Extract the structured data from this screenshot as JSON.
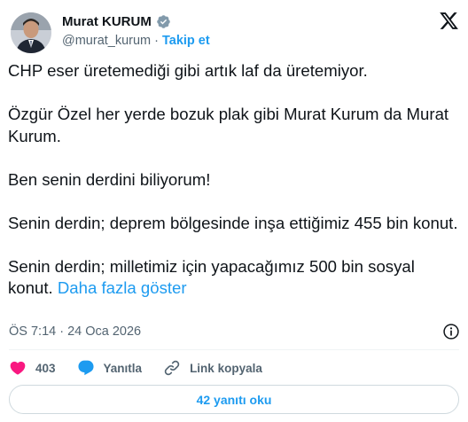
{
  "author": {
    "name": "Murat KURUM",
    "handle": "@murat_kurum",
    "separator": "·",
    "follow_label": "Takip et"
  },
  "tweet": {
    "paragraphs": [
      "CHP eser üretemediği gibi artık laf da üretemiyor.",
      "Özgür Özel her yerde bozuk plak gibi Murat Kurum da Murat Kurum.",
      "Ben senin derdini biliyorum!",
      "Senin derdin; deprem bölgesinde inşa ettiğimiz 455 bin konut.",
      "Senin derdin; milletimiz için yapacağımız 500 bin sosyal konut."
    ],
    "show_more": "Daha fazla göster"
  },
  "meta": {
    "timestamp": "ÖS 7:14 · 24 Oca 2026"
  },
  "actions": {
    "like_count": "403",
    "reply_label": "Yanıtla",
    "copy_link_label": "Link kopyala"
  },
  "read_replies_label": "42 yanıtı oku",
  "colors": {
    "accent": "#1d9bf0",
    "like": "#f91880",
    "text": "#0f1419",
    "muted": "#536471"
  },
  "icons": [
    "verified-badge-icon",
    "x-logo-icon",
    "info-icon",
    "heart-icon",
    "reply-bubble-icon",
    "link-icon"
  ]
}
